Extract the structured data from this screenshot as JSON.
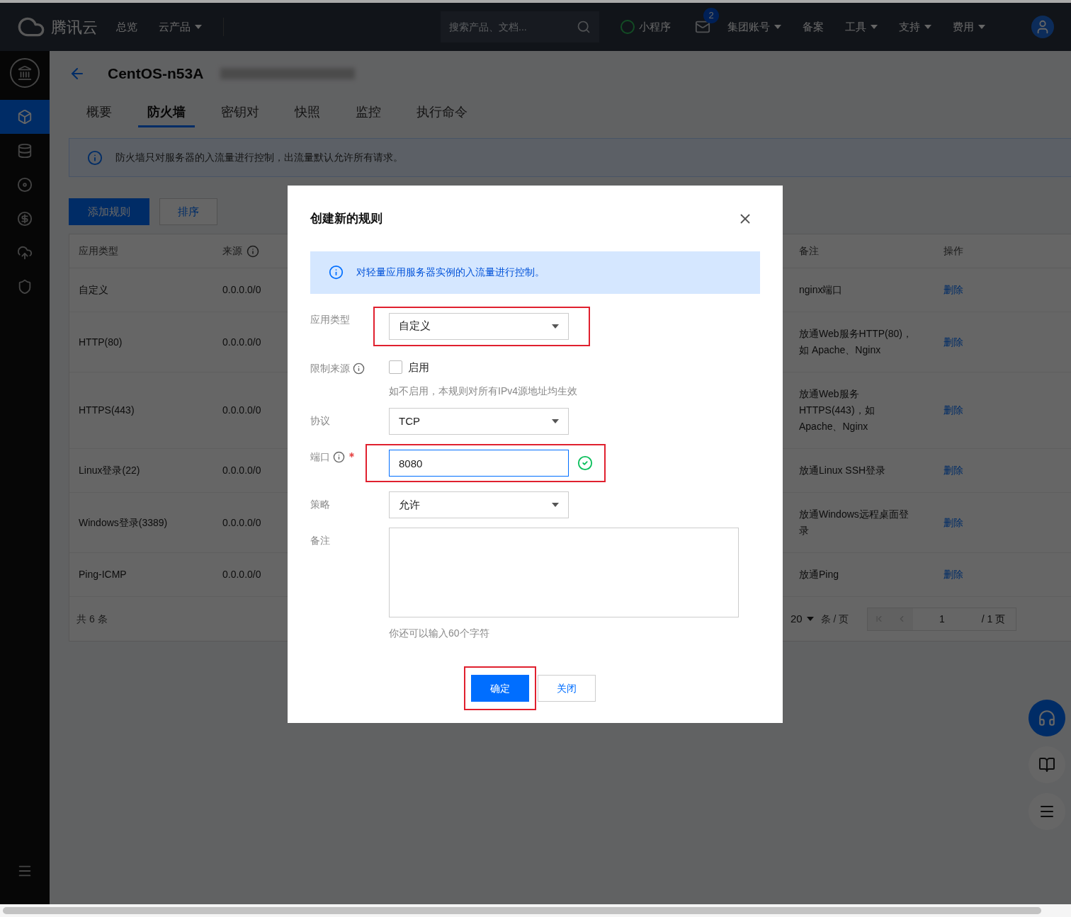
{
  "top_nav": {
    "brand": "腾讯云",
    "items": [
      {
        "label": "总览",
        "dropdown": false
      },
      {
        "label": "云产品",
        "dropdown": true
      }
    ],
    "search": {
      "placeholder": "搜索产品、文档..."
    },
    "mini_program": "小程序",
    "mail_badge": "2",
    "account_items": [
      {
        "label": "集团账号",
        "dropdown": true
      },
      {
        "label": "备案",
        "dropdown": false
      },
      {
        "label": "工具",
        "dropdown": true
      },
      {
        "label": "支持",
        "dropdown": true
      },
      {
        "label": "费用",
        "dropdown": true
      }
    ]
  },
  "sidebar": {
    "items": [
      {
        "kind": "cube",
        "selected": true
      },
      {
        "kind": "database",
        "selected": false
      },
      {
        "kind": "disc",
        "selected": false
      },
      {
        "kind": "coin",
        "selected": false
      },
      {
        "kind": "cloud",
        "selected": false
      },
      {
        "kind": "shield",
        "selected": false
      }
    ]
  },
  "header": {
    "title": "CentOS-n53A"
  },
  "tabs": [
    {
      "label": "概要",
      "selected": false
    },
    {
      "label": "防火墙",
      "selected": true
    },
    {
      "label": "密钥对",
      "selected": false
    },
    {
      "label": "快照",
      "selected": false
    },
    {
      "label": "监控",
      "selected": false
    },
    {
      "label": "执行命令",
      "selected": false
    }
  ],
  "notice": "防火墙只对服务器的入流量进行控制，出流量默认允许所有请求。",
  "toolbar": [
    {
      "label": "添加规则",
      "kind": "primary"
    },
    {
      "label": "排序",
      "kind": "default"
    }
  ],
  "table": {
    "columns": [
      {
        "label": "应用类型",
        "info": false
      },
      {
        "label": "来源",
        "info": true
      },
      {
        "label": "备注",
        "info": false
      },
      {
        "label": "操作",
        "info": false
      }
    ],
    "rows": [
      {
        "type": "自定义",
        "source": "0.0.0.0/0",
        "note": "nginx端口",
        "action": "删除"
      },
      {
        "type": "HTTP(80)",
        "source": "0.0.0.0/0",
        "note": "放通Web服务HTTP(80)，如 Apache、Nginx",
        "action": "删除"
      },
      {
        "type": "HTTPS(443)",
        "source": "0.0.0.0/0",
        "note": "放通Web服务HTTPS(443)，如Apache、Nginx",
        "action": "删除"
      },
      {
        "type": "Linux登录(22)",
        "source": "0.0.0.0/0",
        "note": "放通Linux SSH登录",
        "action": "删除"
      },
      {
        "type": "Windows登录(3389)",
        "source": "0.0.0.0/0",
        "note": "放通Windows远程桌面登录",
        "action": "删除"
      },
      {
        "type": "Ping-ICMP",
        "source": "0.0.0.0/0",
        "note": "放通Ping",
        "action": "删除"
      }
    ],
    "footer": {
      "total": "共 6 条",
      "page_size": "20",
      "page_size_unit": "条 / 页",
      "page": "1",
      "page_total": "/ 1 页"
    }
  },
  "dialog": {
    "title": "创建新的规则",
    "notice": "对轻量应用服务器实例的入流量进行控制。",
    "fields": [
      {
        "kind": "select",
        "label": "应用类型",
        "value": "自定义",
        "highlighted": true
      },
      {
        "kind": "checkbox",
        "label": "限制来源",
        "info": true,
        "checked": false,
        "option": "启用",
        "hint": "如不启用，本规则对所有IPv4源地址均生效"
      },
      {
        "kind": "select",
        "label": "协议",
        "value": "TCP",
        "highlighted": false
      },
      {
        "kind": "input",
        "label": "端口",
        "info": true,
        "required": true,
        "value": "8080",
        "valid": true,
        "highlighted": true
      },
      {
        "kind": "select",
        "label": "策略",
        "value": "允许",
        "highlighted": false
      },
      {
        "kind": "textarea",
        "label": "备注",
        "hint": "你还可以输入60个字符"
      }
    ],
    "buttons": [
      {
        "label": "确定",
        "kind": "primary",
        "highlighted": true
      },
      {
        "label": "关闭",
        "kind": "default",
        "highlighted": false
      }
    ]
  }
}
